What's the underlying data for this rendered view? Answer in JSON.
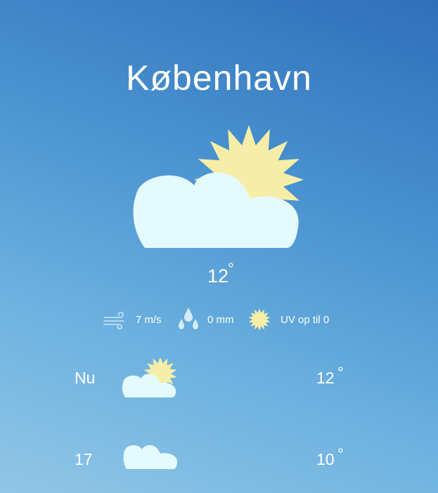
{
  "location": {
    "city": "København"
  },
  "current": {
    "temperature": "12",
    "degree_symbol": "°",
    "condition_icon": "partly-cloudy-icon"
  },
  "details": {
    "wind": {
      "icon": "wind-icon",
      "value": "7 m/s"
    },
    "precipitation": {
      "icon": "raindrops-icon",
      "value": "0 mm"
    },
    "uv": {
      "icon": "sun-icon",
      "value": "UV op til 0"
    }
  },
  "forecast": [
    {
      "time": "Nu",
      "icon": "partly-cloudy-icon",
      "temperature": "12",
      "degree_symbol": "°"
    },
    {
      "time": "17",
      "icon": "cloud-icon",
      "temperature": "10",
      "degree_symbol": "°"
    }
  ],
  "colors": {
    "cloud": "#e4fbfd",
    "sun": "#f6eea8",
    "icon_light": "#cfe6f6",
    "background_top": "#2f6fba",
    "background_bottom": "#92c6e6"
  }
}
